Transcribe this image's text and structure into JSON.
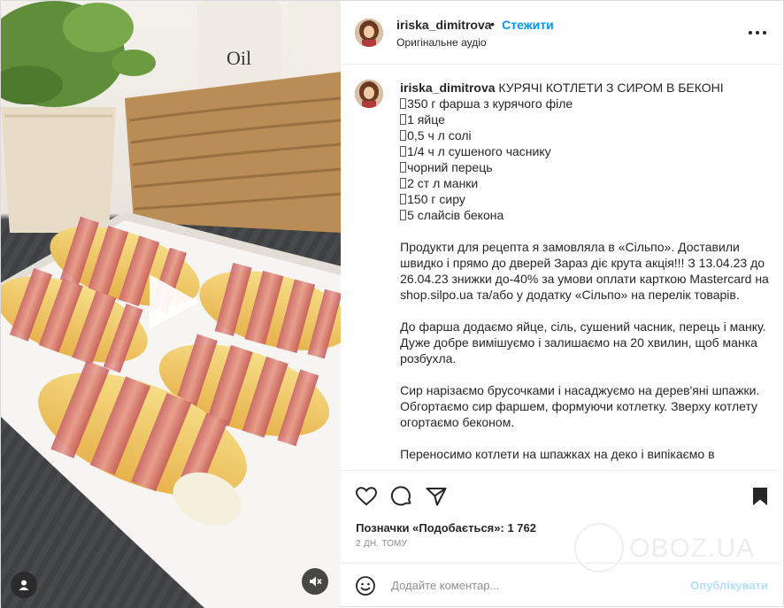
{
  "media": {
    "play_icon": "play-icon",
    "user_icon": "user-tag-icon",
    "mute_icon": "mute-icon"
  },
  "header": {
    "username": "iriska_dimitrova",
    "separator": "•",
    "follow_label": "Стежити",
    "audio_label": "Оригінальне аудіо",
    "more_icon": "more-options-icon"
  },
  "caption": {
    "username": "iriska_dimitrova",
    "title": "КУРЯЧІ КОТЛЕТИ З СИРОМ В БЕКОНІ",
    "ingredients": [
      "350 г фарша з курячого філе",
      "1 яйце",
      "0,5 ч л солі",
      "1/4 ч л сушеного часнику",
      "чорний перець",
      "2 ст л манки",
      "150 г сиру",
      "5 слайсів бекона"
    ],
    "paragraph1": "Продукти для рецепта я замовляла в «Сільпо». Доставили швидко і прямо до дверей Зараз діє крута акція!!! З 13.04.23 до 26.04.23 знижки до-40% за умови оплати карткою Mastercard на shop.silpo.ua та/або у додатку «Сільпо» на перелік товарів.",
    "paragraph2": "До фарша додаємо яйце, сіль, сушений часник, перець і манку. Дуже добре вимішуємо і залишаємо на 20 хвилин, щоб манка розбухла.",
    "paragraph3": "Сир нарізаємо брусочками і насаджуємо на дерев'яні шпажки. Обгортаємо сир фаршем, формуючи котлетку. Зверху котлету огортаємо беконом.",
    "paragraph4": "Переносимо котлети на шпажках на деко і випікаємо в"
  },
  "actions": {
    "like_icon": "heart-icon",
    "comment_icon": "comment-icon",
    "share_icon": "share-icon",
    "save_icon": "bookmark-icon"
  },
  "likes": {
    "label": "Позначки «Подобається»:",
    "count": "1 762"
  },
  "date": "2 ДН. ТОМУ",
  "comment": {
    "emoji_icon": "emoji-icon",
    "placeholder": "Додайте коментар...",
    "publish_label": "Опублікувати"
  },
  "watermark": "OBOZ.UA",
  "colors": {
    "accent": "#0095f6",
    "publish_disabled": "#b2dffc",
    "text": "#262626",
    "muted": "#8e8e8e"
  }
}
